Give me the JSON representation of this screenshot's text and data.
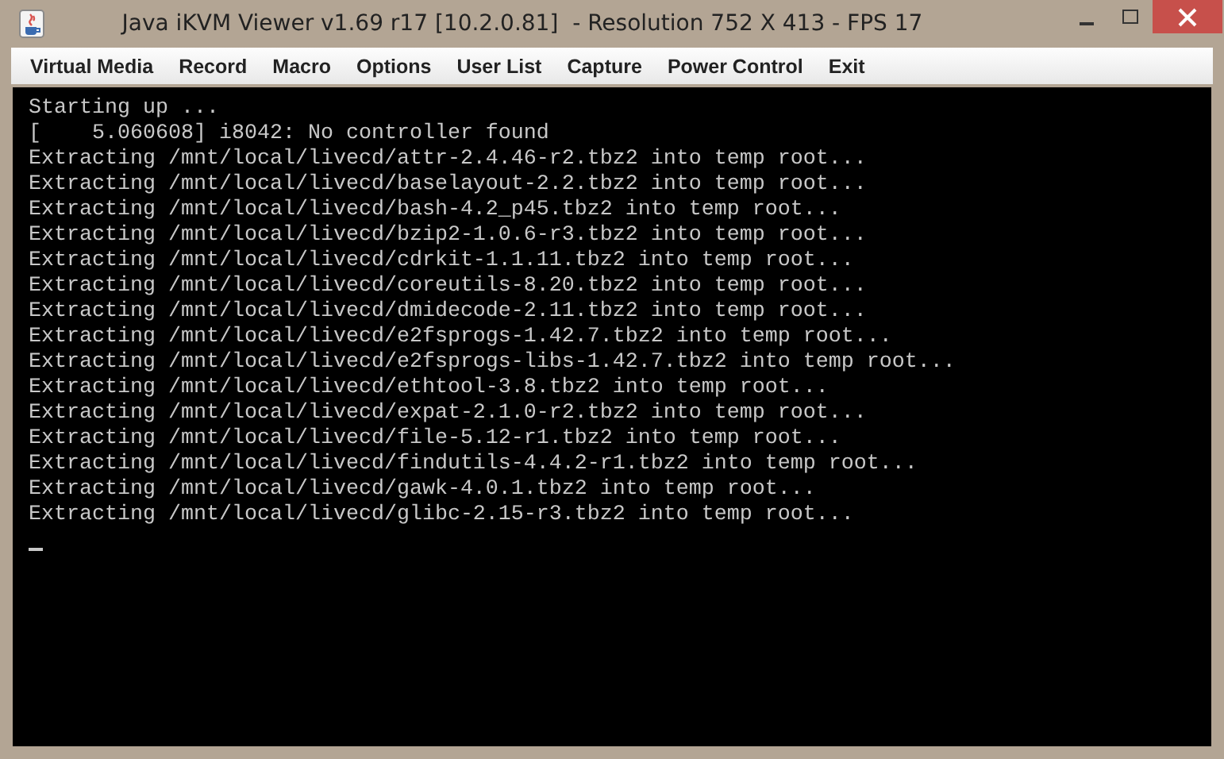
{
  "window": {
    "title": "Java iKVM Viewer v1.69 r17 [10.2.0.81]  - Resolution 752 X 413 - FPS 17"
  },
  "menu": [
    "Virtual Media",
    "Record",
    "Macro",
    "Options",
    "User List",
    "Capture",
    "Power Control",
    "Exit"
  ],
  "console": {
    "lines": [
      "Starting up ...",
      "[    5.060608] i8042: No controller found",
      "Extracting /mnt/local/livecd/attr-2.4.46-r2.tbz2 into temp root...",
      "Extracting /mnt/local/livecd/baselayout-2.2.tbz2 into temp root...",
      "Extracting /mnt/local/livecd/bash-4.2_p45.tbz2 into temp root...",
      "Extracting /mnt/local/livecd/bzip2-1.0.6-r3.tbz2 into temp root...",
      "Extracting /mnt/local/livecd/cdrkit-1.1.11.tbz2 into temp root...",
      "Extracting /mnt/local/livecd/coreutils-8.20.tbz2 into temp root...",
      "Extracting /mnt/local/livecd/dmidecode-2.11.tbz2 into temp root...",
      "Extracting /mnt/local/livecd/e2fsprogs-1.42.7.tbz2 into temp root...",
      "Extracting /mnt/local/livecd/e2fsprogs-libs-1.42.7.tbz2 into temp root...",
      "Extracting /mnt/local/livecd/ethtool-3.8.tbz2 into temp root...",
      "Extracting /mnt/local/livecd/expat-2.1.0-r2.tbz2 into temp root...",
      "Extracting /mnt/local/livecd/file-5.12-r1.tbz2 into temp root...",
      "Extracting /mnt/local/livecd/findutils-4.4.2-r1.tbz2 into temp root...",
      "Extracting /mnt/local/livecd/gawk-4.0.1.tbz2 into temp root...",
      "Extracting /mnt/local/livecd/glibc-2.15-r3.tbz2 into temp root..."
    ]
  }
}
